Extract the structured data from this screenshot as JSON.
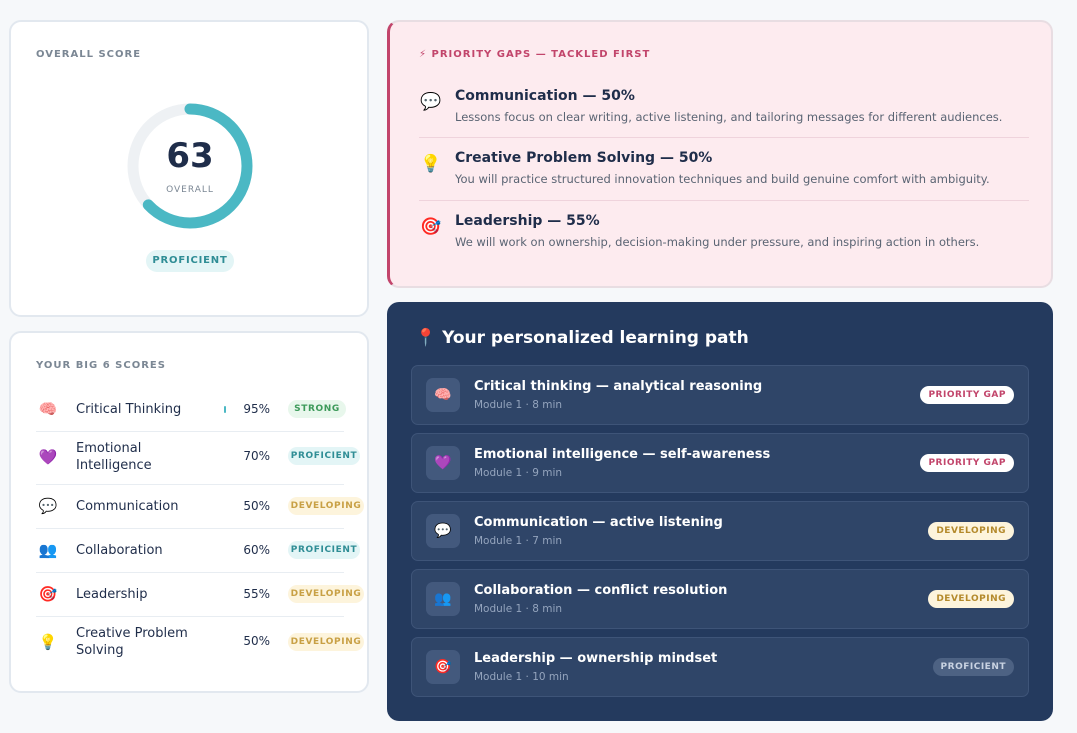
{
  "overall": {
    "caption": "OVERALL SCORE",
    "score": "63",
    "score_value": 63,
    "sub": "OVERALL",
    "badge": "PROFICIENT",
    "ring_color": "#4bb8c4",
    "track_color": "#eef1f4"
  },
  "big6": {
    "caption": "YOUR BIG 6 SCORES",
    "rows": [
      {
        "emoji": "🧠",
        "name": "Critical Thinking",
        "pct": "95%",
        "tag": "STRONG"
      },
      {
        "emoji": "💜",
        "name": "Emotional Intelligence",
        "pct": "70%",
        "tag": "PROFICIENT"
      },
      {
        "emoji": "💬",
        "name": "Communication",
        "pct": "50%",
        "tag": "DEVELOPING"
      },
      {
        "emoji": "👥",
        "name": "Collaboration",
        "pct": "60%",
        "tag": "PROFICIENT"
      },
      {
        "emoji": "🎯",
        "name": "Leadership",
        "pct": "55%",
        "tag": "DEVELOPING"
      },
      {
        "emoji": "💡",
        "name": "Creative Problem Solving",
        "pct": "50%",
        "tag": "DEVELOPING"
      }
    ]
  },
  "priority": {
    "caption": "PRIORITY GAPS — TACKLED FIRST",
    "caption_icon": "⚡",
    "items": [
      {
        "emoji": "💬",
        "title": "Communication — 50%",
        "desc": "Lessons focus on clear writing, active listening, and tailoring messages for different audiences."
      },
      {
        "emoji": "💡",
        "title": "Creative Problem Solving — 50%",
        "desc": "You will practice structured innovation techniques and build genuine comfort with ambiguity."
      },
      {
        "emoji": "🎯",
        "title": "Leadership — 55%",
        "desc": "We will work on ownership, decision-making under pressure, and inspiring action in others."
      }
    ]
  },
  "path": {
    "icon": "📍",
    "title": "Your personalized learning path",
    "modules": [
      {
        "emoji": "🧠",
        "title": "Critical thinking — analytical reasoning",
        "meta": "Module 1 · 8 min",
        "tag": "PRIORITY GAP"
      },
      {
        "emoji": "💜",
        "title": "Emotional intelligence — self-awareness",
        "meta": "Module 1 · 9 min",
        "tag": "PRIORITY GAP"
      },
      {
        "emoji": "💬",
        "title": "Communication — active listening",
        "meta": "Module 1 · 7 min",
        "tag": "DEVELOPING"
      },
      {
        "emoji": "👥",
        "title": "Collaboration — conflict resolution",
        "meta": "Module 1 · 8 min",
        "tag": "DEVELOPING"
      },
      {
        "emoji": "🎯",
        "title": "Leadership — ownership mindset",
        "meta": "Module 1 · 10 min",
        "tag": "PROFICIENT"
      }
    ]
  }
}
